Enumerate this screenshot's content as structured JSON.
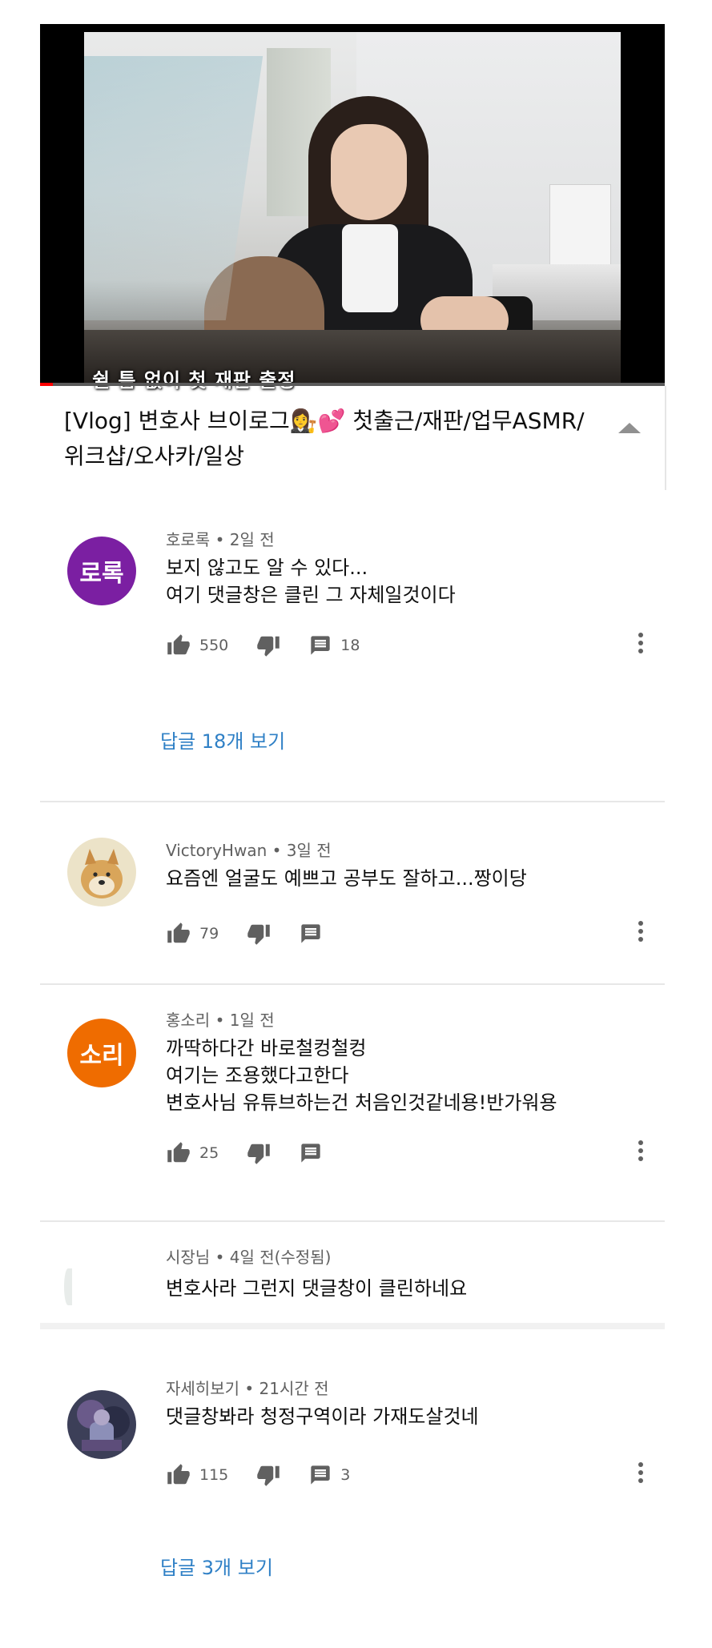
{
  "video": {
    "caption": "쉴 틈 없이 첫 재판 출정",
    "progress": 0.02,
    "progress_color": "#ff0000"
  },
  "title": {
    "text": "[Vlog] 변호사 브이로그👩‍⚖️💕 첫출근/재판/업무ASMR/위크샵/오사카/일상",
    "collapse_icon": "chevron-up-icon"
  },
  "comments": [
    {
      "author": "호로록",
      "time": "2일 전",
      "avatar_text": "로록",
      "avatar_color": "#7b1fa2",
      "text": "보지 않고도 알 수 있다...\n여기 댓글창은 클린 그 자체일것이다",
      "likes": "550",
      "replies_count": "18",
      "replies_link": "답글 18개 보기"
    },
    {
      "author": "VictoryHwan",
      "time": "3일 전",
      "avatar_text": "",
      "avatar_color": "#e4c48f",
      "text": "요즘엔 얼굴도 예쁘고 공부도 잘하고...짱이당",
      "likes": "79",
      "replies_count": ""
    },
    {
      "author": "홍소리",
      "time": "1일 전",
      "avatar_text": "소리",
      "avatar_color": "#ef6c00",
      "text": "까딱하다간 바로철컹철컹\n여기는 조용했다고한다\n변호사님 유튜브하는건 처음인것같네용!반가워용",
      "likes": "25",
      "replies_count": ""
    },
    {
      "author": "시장님",
      "time": "4일 전(수정됨)",
      "text": "변호사라 그런지 댓글창이 클린하네요"
    },
    {
      "author": "자세히보기",
      "time": "21시간 전",
      "avatar_text": "",
      "avatar_color": "#4a4a6a",
      "text": "댓글창봐라 청정구역이라 가재도살것네",
      "likes": "115",
      "replies_count": "3",
      "replies_link": "답글 3개 보기"
    }
  ],
  "meta_separator": "•",
  "colors": {
    "link": "#2f80c6",
    "secondary_text": "#606060",
    "divider": "#e7e7e7"
  }
}
